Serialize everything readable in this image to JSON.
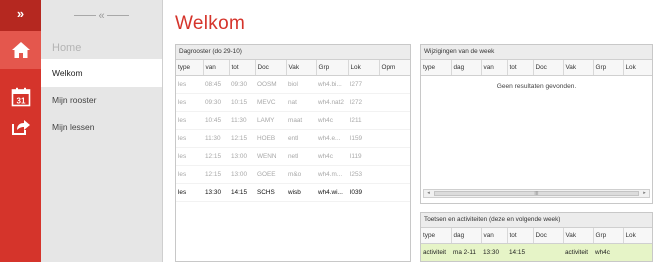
{
  "rail": {
    "collapse_label": "»"
  },
  "nav": {
    "collapse_label": "«",
    "home_label": "Home",
    "items": [
      {
        "label": "Welkom"
      },
      {
        "label": "Mijn rooster"
      },
      {
        "label": "Mijn lessen"
      }
    ]
  },
  "page": {
    "title": "Welkom"
  },
  "dagrooster": {
    "title": "Dagrooster (do 29-10)",
    "columns": [
      "type",
      "van",
      "tot",
      "Doc",
      "Vak",
      "Grp",
      "Lok",
      "Opm"
    ],
    "rows": [
      [
        "les",
        "08:45",
        "09:30",
        "OOSM",
        "biol",
        "wh4.bi...",
        "l277",
        ""
      ],
      [
        "les",
        "09:30",
        "10:15",
        "MEVC",
        "nat",
        "wh4.nat2",
        "l272",
        ""
      ],
      [
        "les",
        "10:45",
        "11:30",
        "LAMY",
        "maat",
        "wh4c",
        "l211",
        ""
      ],
      [
        "les",
        "11:30",
        "12:15",
        "HOEB",
        "entl",
        "wh4.e...",
        "l159",
        ""
      ],
      [
        "les",
        "12:15",
        "13:00",
        "WENN",
        "netl",
        "wh4c",
        "l119",
        ""
      ],
      [
        "les",
        "12:15",
        "13:00",
        "GOEE",
        "m&o",
        "wh4.m...",
        "l253",
        ""
      ],
      [
        "les",
        "13:30",
        "14:15",
        "SCHS",
        "wisb",
        "wh4.wi...",
        "l039",
        ""
      ]
    ]
  },
  "wijzigingen": {
    "title": "Wijzigingen van de week",
    "columns": [
      "type",
      "dag",
      "van",
      "tot",
      "Doc",
      "Vak",
      "Grp",
      "Lok"
    ],
    "empty_text": "Geen resultaten gevonden.",
    "scroll_mid": "III",
    "scroll_left": "◂",
    "scroll_right": "▸"
  },
  "toetsen": {
    "title": "Toetsen en activiteiten (deze en volgende week)",
    "columns": [
      "type",
      "dag",
      "van",
      "tot",
      "Doc",
      "Vak",
      "Grp",
      "Lok"
    ],
    "rows": [
      [
        "activiteit",
        "ma 2-11",
        "13:30",
        "14:15",
        "",
        "activiteit",
        "wh4c",
        ""
      ]
    ]
  },
  "colors": {
    "accent": "#d5342b",
    "rail_active": "#e4574d",
    "activity_row": "#e6f4c7"
  }
}
